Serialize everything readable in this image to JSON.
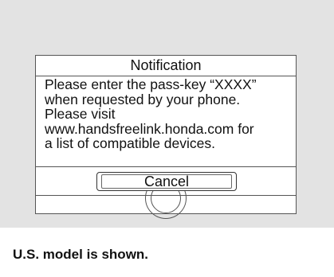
{
  "dialog": {
    "title": "Notification",
    "message": "Please enter the pass-key “XXXX”\nwhen requested by your phone.\nPlease visit\nwww.handsfreelink.honda.com for\na list of compatible devices.",
    "cancel_label": "Cancel"
  },
  "caption": "U.S. model is shown."
}
